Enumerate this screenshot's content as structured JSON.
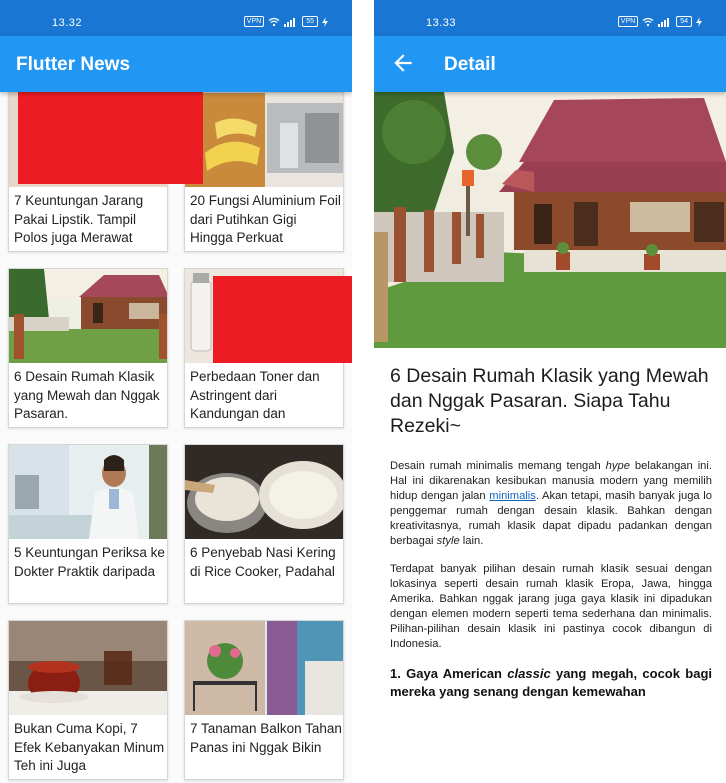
{
  "left_screen": {
    "status": {
      "time": "13.32",
      "vpn": "VPN",
      "wifi": "wifi-icon",
      "signal": "signal-icon",
      "battery": "55",
      "charging": "bolt-icon"
    },
    "app_title": "Flutter News",
    "cards": [
      {
        "caption": "7 Keuntungan Jarang Pakai Lipstik. Tampil Polos juga Merawat"
      },
      {
        "caption": "20 Fungsi Aluminium Foil dari Putihkan Gigi Hingga Perkuat"
      },
      {
        "caption": "6 Desain Rumah Klasik yang Mewah dan Nggak Pasaran."
      },
      {
        "caption": "Perbedaan Toner dan Astringent dari Kandungan dan"
      },
      {
        "caption": "5 Keuntungan Periksa ke Dokter Praktik daripada"
      },
      {
        "caption": "6 Penyebab Nasi Kering di Rice Cooker, Padahal"
      },
      {
        "caption": "Bukan Cuma Kopi, 7 Efek Kebanyakan Minum Teh ini Juga"
      },
      {
        "caption": "7 Tanaman Balkon Tahan Panas ini Nggak Bikin"
      }
    ]
  },
  "right_screen": {
    "status": {
      "time": "13.33",
      "vpn": "VPN",
      "wifi": "wifi-icon",
      "signal": "signal-icon",
      "battery": "54",
      "charging": "bolt-icon"
    },
    "app_title": "Detail",
    "back_icon": "arrow-back-icon",
    "headline": "6 Desain Rumah Klasik yang Mewah dan Nggak Pasaran. Siapa Tahu Rezeki~",
    "paragraph1": {
      "part1": "Desain rumah minimalis memang tengah ",
      "em1": "hype",
      "part2": " belakangan ini. Hal ini dikarenakan kesibukan manusia modern yang memilih hidup dengan jalan ",
      "link": "minimalis",
      "part3": ". Akan tetapi, masih banyak juga lo penggemar rumah dengan desain klasik. Bahkan dengan kreativitasnya, rumah klasik dapat dipadu padankan dengan berbagai ",
      "em2": "style",
      "part4": " lain."
    },
    "paragraph2": "Terdapat banyak pilihan desain rumah klasik sesuai dengan lokasinya seperti desain rumah klasik Eropa, Jawa, hingga Amerika. Bahkan nggak jarang juga gaya klasik ini dipadukan dengan elemen modern seperti tema sederhana dan minimalis. Pilihan-pilihan desain klasik ini pastinya cocok dibangun di Indonesia.",
    "subheading": {
      "part1": "1. Gaya American ",
      "em": "classic",
      "part2": " yang megah, cocok bagi mereka yang senang dengan kemewahan"
    }
  }
}
